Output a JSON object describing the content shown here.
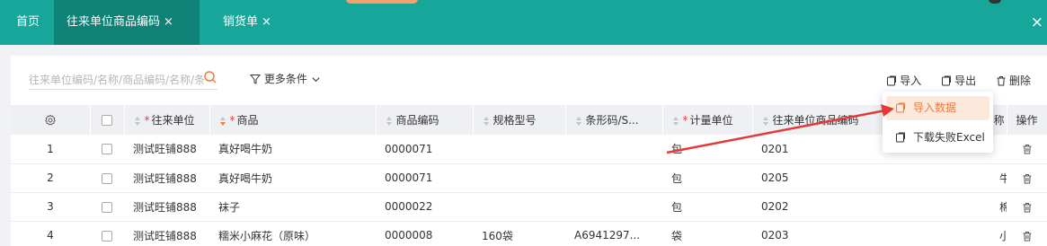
{
  "tabs": {
    "home": "首页",
    "active": "往来单位商品编码",
    "sales": "销货单",
    "close_glyph": "×"
  },
  "toolbar": {
    "search_placeholder": "往来单位编码/名称/商品编码/名称/条",
    "more_filters": "更多条件",
    "import": "导入",
    "export": "导出",
    "delete": "删除"
  },
  "dropdown": {
    "import_data": "导入数据",
    "download_failed": "下载失败Excel"
  },
  "table": {
    "headers": {
      "partner": "往来单位",
      "product": "商品",
      "product_code": "商品编码",
      "spec": "规格型号",
      "barcode": "条形码/S...",
      "unit": "计量单位",
      "partner_code": "往来单位商品编码",
      "partner_name": "名称",
      "ops": "操作"
    },
    "rows": [
      {
        "idx": "1",
        "partner": "测试旺铺888",
        "product": "真好喝牛奶",
        "code": "0000071",
        "spec": "",
        "barcode": "",
        "unit": "包",
        "pcode": "0201",
        "pname": ""
      },
      {
        "idx": "2",
        "partner": "测试旺铺888",
        "product": "真好喝牛奶",
        "code": "0000071",
        "spec": "",
        "barcode": "",
        "unit": "包",
        "pcode": "0205",
        "pname": "牛奶"
      },
      {
        "idx": "3",
        "partner": "测试旺铺888",
        "product": "袜子",
        "code": "0000022",
        "spec": "",
        "barcode": "",
        "unit": "包",
        "pcode": "0202",
        "pname": "棉袜"
      },
      {
        "idx": "4",
        "partner": "测试旺铺888",
        "product": "糯米小麻花（原味）",
        "code": "0000008",
        "spec": "160袋",
        "barcode": "A6941297...",
        "unit": "袋",
        "pcode": "0203",
        "pname": "小零食"
      }
    ]
  },
  "colors": {
    "topbar": "#17a79a",
    "active_tab": "#0f8277",
    "accent": "#f07a3e",
    "annotation_arrow": "#e53935"
  }
}
